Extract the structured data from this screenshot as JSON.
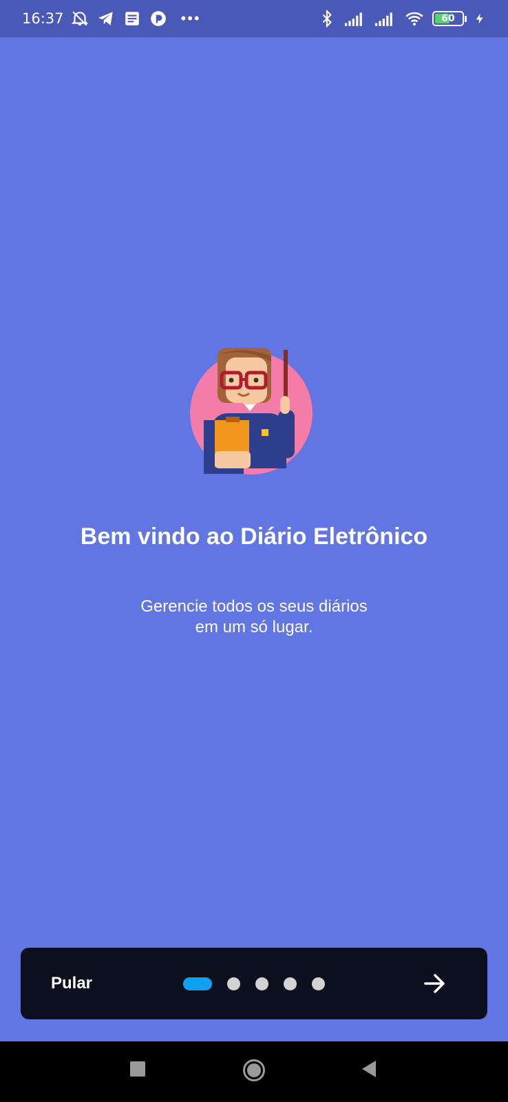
{
  "status_bar": {
    "time": "16:37",
    "battery_level": 60,
    "battery_label": "60",
    "left_icons": [
      "alarm-off-icon",
      "telegram-icon",
      "news-icon",
      "app-icon",
      "more-dots-icon"
    ],
    "right_icons": [
      "bluetooth-icon",
      "signal-icon",
      "signal-icon",
      "wifi-icon",
      "battery-icon",
      "charging-icon"
    ],
    "more": "•••"
  },
  "onboarding": {
    "title": "Bem vindo ao Diário Eletrônico",
    "subtitle_line1": "Gerencie todos os seus  diários",
    "subtitle_line2": "em um só lugar.",
    "illustration": "teacher-icon"
  },
  "bottom_bar": {
    "skip_label": "Pular",
    "page_count": 5,
    "current_page": 1,
    "next_icon": "arrow-right-icon"
  },
  "colors": {
    "background": "#6175E3",
    "status_bar": "#4A58B8",
    "bottom_bar": "#0C0F1E",
    "active_indicator": "#0FA3EF",
    "inactive_indicator": "#D3D3D3"
  },
  "nav_bar": {
    "items": [
      "recents-icon",
      "home-icon",
      "back-icon"
    ]
  }
}
